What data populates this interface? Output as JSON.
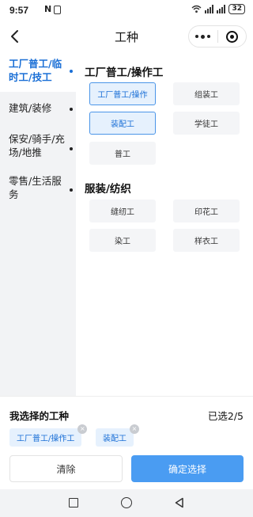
{
  "status_bar": {
    "time": "9:57",
    "battery": "32",
    "icons": [
      "n-icon",
      "sim-icon",
      "wifi-icon",
      "signal-icon",
      "signal-icon",
      "battery-icon"
    ]
  },
  "nav": {
    "title": "工种",
    "back_icon": "chevron-left-icon",
    "more_icon": "more-dots-icon",
    "close_icon": "target-close-icon"
  },
  "sidebar": {
    "items": [
      {
        "label": "工厂普工/临时工/技工",
        "active": true
      },
      {
        "label": "建筑/装修",
        "active": false
      },
      {
        "label": "保安/骑手/充场/地推",
        "active": false
      },
      {
        "label": "零售/生活服务",
        "active": false
      }
    ]
  },
  "content": {
    "sections": [
      {
        "title": "工厂普工/操作工",
        "options": [
          {
            "label": "工厂普工/操作",
            "selected": true
          },
          {
            "label": "组装工",
            "selected": false
          },
          {
            "label": "装配工",
            "selected": true
          },
          {
            "label": "学徒工",
            "selected": false
          },
          {
            "label": "普工",
            "selected": false
          }
        ]
      },
      {
        "title": "服装/纺织",
        "options": [
          {
            "label": "缝纫工",
            "selected": false
          },
          {
            "label": "印花工",
            "selected": false
          },
          {
            "label": "染工",
            "selected": false
          },
          {
            "label": "样衣工",
            "selected": false
          }
        ]
      }
    ]
  },
  "selection": {
    "title": "我选择的工种",
    "count_label": "已选2/5",
    "tags": [
      "工厂普工/操作工",
      "装配工"
    ],
    "remove_symbol": "×"
  },
  "actions": {
    "clear_label": "清除",
    "confirm_label": "确定选择"
  },
  "colors": {
    "accent": "#1a6fd6",
    "confirm_button": "#4a9cf2",
    "selected_bg": "#e6f1fd",
    "sidebar_bg": "#f2f3f5"
  }
}
